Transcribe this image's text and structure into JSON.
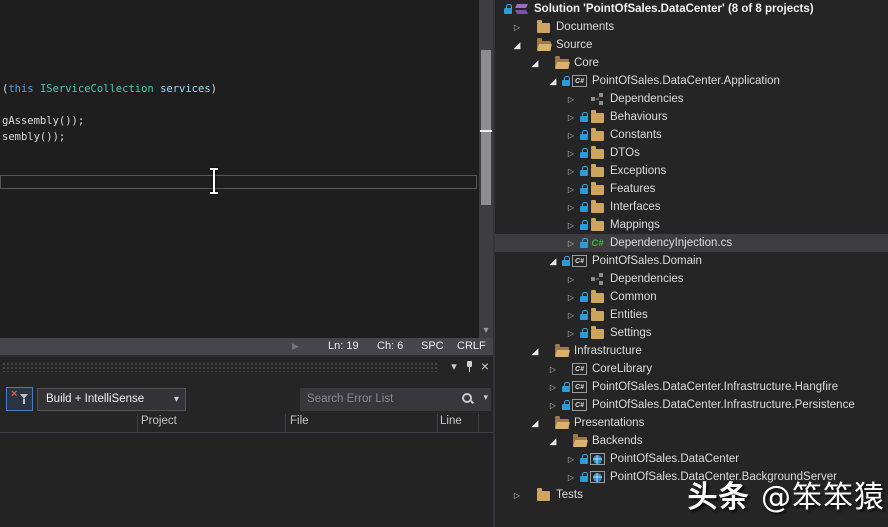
{
  "colors": {
    "editor_background": "#1E1E1E",
    "panel_background": "#252526",
    "selection_background": "#3D3D40",
    "accent_filter_border": "#4B7CC4",
    "folder_icon": "#CEA55F",
    "lock_icon": "#2E9BD6",
    "csharp_file_green": "#48B348",
    "keyword_blue": "#569CD6",
    "type_teal": "#4EC9B0",
    "parameter_blue": "#9CDCFE"
  },
  "editor": {
    "palette": {
      "default": "#DCDCDC",
      "keyword": "#569CD6",
      "type": "#4EC9B0",
      "param": "#9CDCFE"
    },
    "code_lines": [
      {
        "segments": [
          {
            "t": "(",
            "c": "default"
          },
          {
            "t": "this",
            "c": "keyword"
          },
          {
            "t": " ",
            "c": "default"
          },
          {
            "t": "IServiceCollection",
            "c": "type"
          },
          {
            "t": " ",
            "c": "default"
          },
          {
            "t": "services",
            "c": "param"
          },
          {
            "t": ")",
            "c": "default"
          }
        ]
      },
      {
        "segments": []
      },
      {
        "segments": [
          {
            "t": "gAssembly());",
            "c": "default"
          }
        ]
      },
      {
        "segments": [
          {
            "t": "sembly());",
            "c": "default"
          }
        ]
      }
    ],
    "status": {
      "line": "Ln: 19",
      "column": "Ch: 6",
      "spaces": "SPC",
      "line_ending": "CRLF"
    }
  },
  "error_list": {
    "filter_label": "Build + IntelliSense",
    "search_placeholder": "Search Error List",
    "columns": [
      {
        "label": "Project"
      },
      {
        "label": "File"
      },
      {
        "label": "Line"
      }
    ]
  },
  "solution_explorer": {
    "items": [
      {
        "label": "Solution 'PointOfSales.DataCenter' (8 of 8 projects)",
        "level": 0,
        "expander": "none",
        "icon": "solution",
        "lock": true,
        "bold": true,
        "selected": false
      },
      {
        "label": "Documents",
        "level": 1,
        "expander": "collapsed",
        "icon": "folder",
        "lock": false,
        "bold": false,
        "selected": false
      },
      {
        "label": "Source",
        "level": 1,
        "expander": "expanded",
        "icon": "folder-open",
        "lock": false,
        "bold": false,
        "selected": false
      },
      {
        "label": "Core",
        "level": 2,
        "expander": "expanded",
        "icon": "folder-open",
        "lock": false,
        "bold": false,
        "selected": false
      },
      {
        "label": "PointOfSales.DataCenter.Application",
        "level": 3,
        "expander": "expanded",
        "icon": "csharp-project",
        "lock": true,
        "bold": false,
        "selected": false
      },
      {
        "label": "Dependencies",
        "level": 4,
        "expander": "collapsed",
        "icon": "dependencies",
        "lock": false,
        "bold": false,
        "selected": false
      },
      {
        "label": "Behaviours",
        "level": 4,
        "expander": "collapsed",
        "icon": "folder",
        "lock": true,
        "bold": false,
        "selected": false
      },
      {
        "label": "Constants",
        "level": 4,
        "expander": "collapsed",
        "icon": "folder",
        "lock": true,
        "bold": false,
        "selected": false
      },
      {
        "label": "DTOs",
        "level": 4,
        "expander": "collapsed",
        "icon": "folder",
        "lock": true,
        "bold": false,
        "selected": false
      },
      {
        "label": "Exceptions",
        "level": 4,
        "expander": "collapsed",
        "icon": "folder",
        "lock": true,
        "bold": false,
        "selected": false
      },
      {
        "label": "Features",
        "level": 4,
        "expander": "collapsed",
        "icon": "folder",
        "lock": true,
        "bold": false,
        "selected": false
      },
      {
        "label": "Interfaces",
        "level": 4,
        "expander": "collapsed",
        "icon": "folder",
        "lock": true,
        "bold": false,
        "selected": false
      },
      {
        "label": "Mappings",
        "level": 4,
        "expander": "collapsed",
        "icon": "folder",
        "lock": true,
        "bold": false,
        "selected": false
      },
      {
        "label": "DependencyInjection.cs",
        "level": 4,
        "expander": "collapsed",
        "icon": "csharp-file",
        "lock": true,
        "bold": false,
        "selected": true
      },
      {
        "label": "PointOfSales.Domain",
        "level": 3,
        "expander": "expanded",
        "icon": "csharp-project",
        "lock": true,
        "bold": false,
        "selected": false
      },
      {
        "label": "Dependencies",
        "level": 4,
        "expander": "collapsed",
        "icon": "dependencies",
        "lock": false,
        "bold": false,
        "selected": false
      },
      {
        "label": "Common",
        "level": 4,
        "expander": "collapsed",
        "icon": "folder",
        "lock": true,
        "bold": false,
        "selected": false
      },
      {
        "label": "Entities",
        "level": 4,
        "expander": "collapsed",
        "icon": "folder",
        "lock": true,
        "bold": false,
        "selected": false
      },
      {
        "label": "Settings",
        "level": 4,
        "expander": "collapsed",
        "icon": "folder",
        "lock": true,
        "bold": false,
        "selected": false
      },
      {
        "label": "Infrastructure",
        "level": 2,
        "expander": "expanded",
        "icon": "folder-open",
        "lock": false,
        "bold": false,
        "selected": false
      },
      {
        "label": "CoreLibrary",
        "level": 3,
        "expander": "collapsed",
        "icon": "csharp-project",
        "lock": false,
        "bold": false,
        "selected": false
      },
      {
        "label": "PointOfSales.DataCenter.Infrastructure.Hangfire",
        "level": 3,
        "expander": "collapsed",
        "icon": "csharp-project",
        "lock": true,
        "bold": false,
        "selected": false
      },
      {
        "label": "PointOfSales.DataCenter.Infrastructure.Persistence",
        "level": 3,
        "expander": "collapsed",
        "icon": "csharp-project",
        "lock": true,
        "bold": false,
        "selected": false
      },
      {
        "label": "Presentations",
        "level": 2,
        "expander": "expanded",
        "icon": "folder-open",
        "lock": false,
        "bold": false,
        "selected": false
      },
      {
        "label": "Backends",
        "level": 3,
        "expander": "expanded",
        "icon": "folder-open",
        "lock": false,
        "bold": false,
        "selected": false
      },
      {
        "label": "PointOfSales.DataCenter",
        "level": 4,
        "expander": "collapsed",
        "icon": "web-project",
        "lock": true,
        "bold": false,
        "selected": false
      },
      {
        "label": "PointOfSales.DataCenter.BackgroundServer",
        "level": 4,
        "expander": "collapsed",
        "icon": "web-project",
        "lock": true,
        "bold": false,
        "selected": false
      },
      {
        "label": "Tests",
        "level": 1,
        "expander": "collapsed",
        "icon": "folder",
        "lock": false,
        "bold": false,
        "selected": false
      }
    ]
  },
  "watermark": {
    "primary": "头条 ",
    "secondary": "@笨笨猿"
  }
}
